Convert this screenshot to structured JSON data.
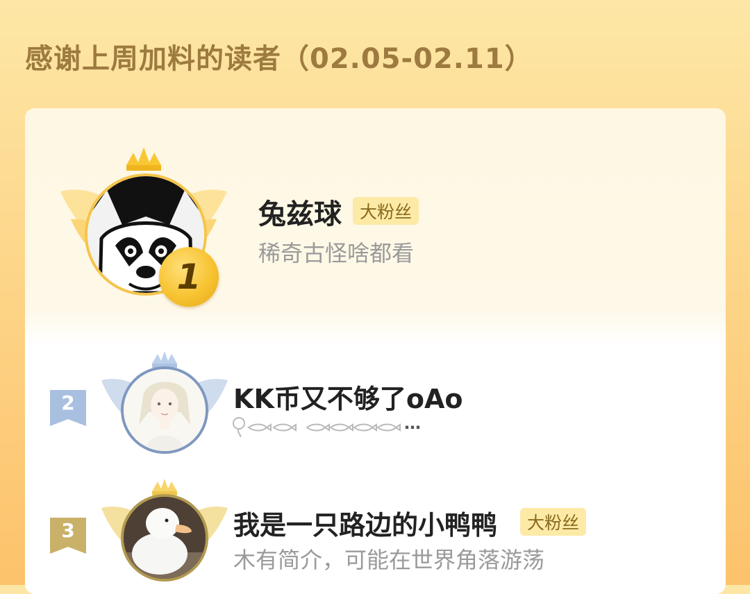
{
  "header": {
    "title": "感谢上周加料的读者（02.05-02.11）"
  },
  "colors": {
    "background_top": "#fde7a6",
    "background_bottom": "#fdc26b",
    "title": "#9d7a3f",
    "badge_bg": "#fceaa6",
    "gold": "#f7c332",
    "silver": "#8da6c9",
    "bronze": "#c9b169"
  },
  "readers": [
    {
      "rank": "1",
      "name": "兔兹球",
      "badge": "大粉丝",
      "description": "稀奇古怪啥都看",
      "avatar_icon": "husky-dog-avatar"
    },
    {
      "rank": "2",
      "name": "KK币又不够了oAo",
      "badge": "",
      "description": "…",
      "avatar_icon": "anime-character-avatar"
    },
    {
      "rank": "3",
      "name": "我是一只路边的小鸭鸭",
      "badge": "大粉丝",
      "description": "木有简介，可能在世界角落游荡",
      "avatar_icon": "white-duck-avatar"
    }
  ]
}
